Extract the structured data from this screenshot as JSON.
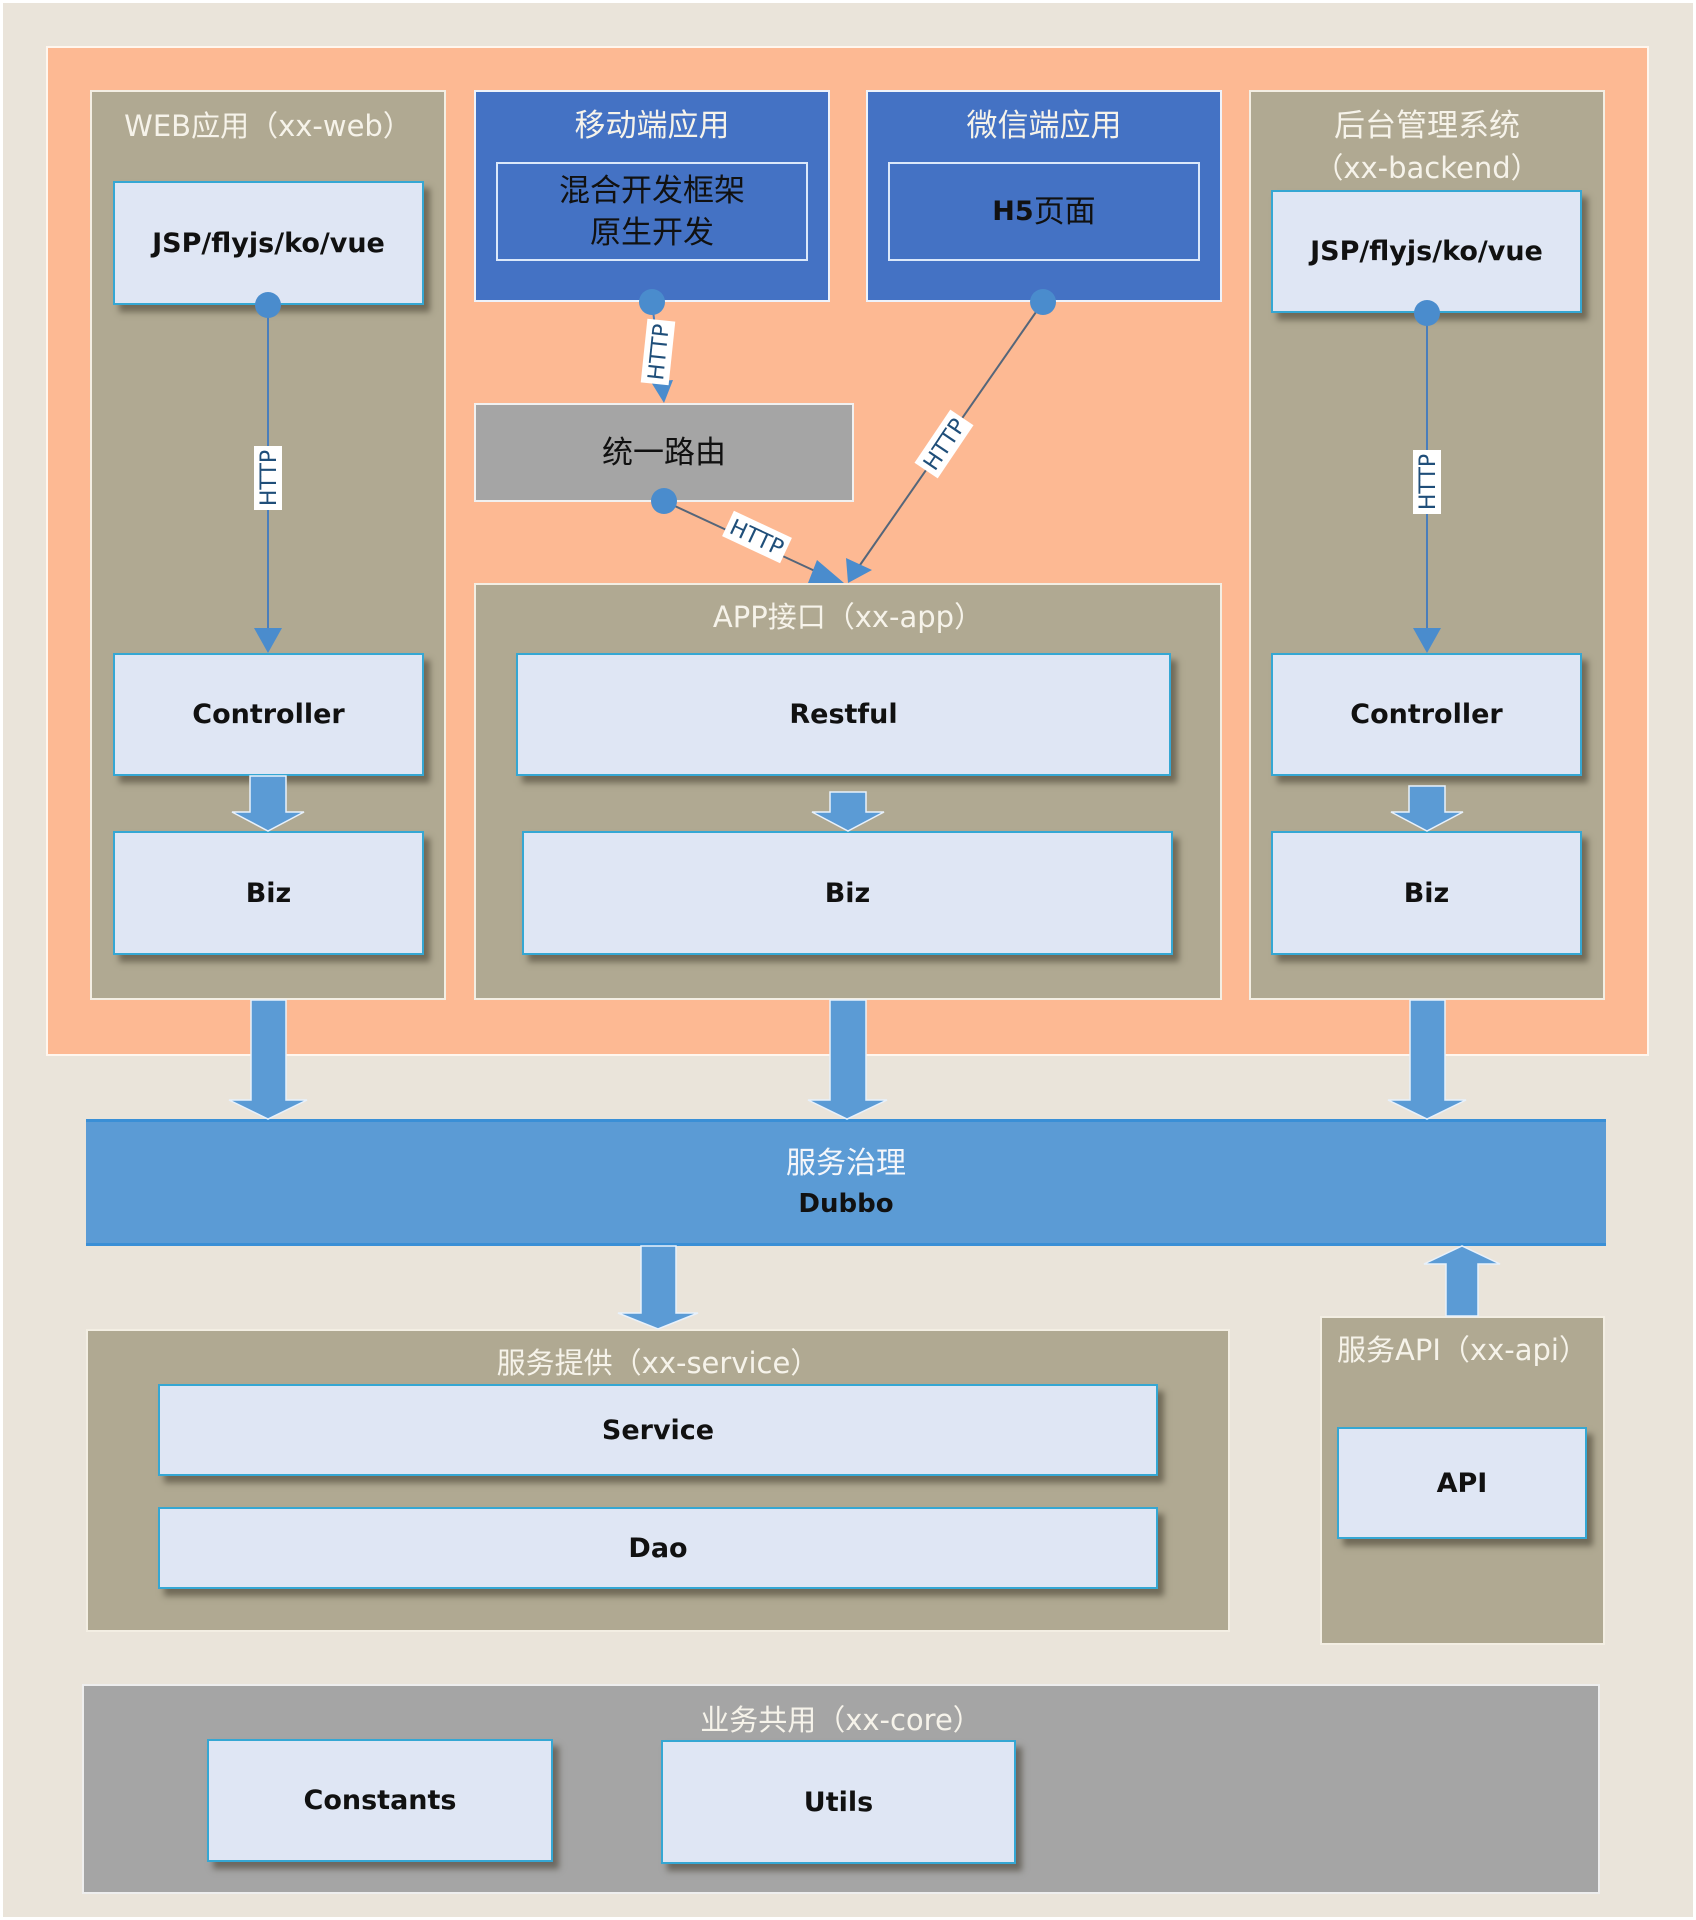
{
  "colors": {
    "background": "#EAE4DA",
    "frontend_zone": "#FDB993",
    "panel": "#B0A992",
    "client_panel": "#4472C4",
    "router": "#A5A5A5",
    "module_fill": "#DFE6F4",
    "module_border": "#35A7D3",
    "arrow": "#5B9BD5",
    "service_bus": "#5B9BD5",
    "core_panel": "#A5A5A5"
  },
  "web": {
    "title": "WEB应用（xx-web）",
    "view": "JSP/flyjs/ko/vue",
    "controller": "Controller",
    "biz": "Biz",
    "link_label": "HTTP"
  },
  "mobile": {
    "title": "移动端应用",
    "line1": "混合开发框架",
    "line2": "原生开发",
    "link_label": "HTTP"
  },
  "wechat": {
    "title": "微信端应用",
    "page_bold": "H5",
    "page_rest": "页面",
    "link_label": "HTTP"
  },
  "router": {
    "label": "统一路由",
    "link_label": "HTTP"
  },
  "backend": {
    "title_line1": "后台管理系统",
    "title_line2": "（xx-backend）",
    "view": "JSP/flyjs/ko/vue",
    "controller": "Controller",
    "biz": "Biz",
    "link_label": "HTTP"
  },
  "app": {
    "title": "APP接口（xx-app）",
    "restful": "Restful",
    "biz": "Biz"
  },
  "governance": {
    "title": "服务治理",
    "subtitle": "Dubbo"
  },
  "service": {
    "title": "服务提供（xx-service）",
    "service": "Service",
    "dao": "Dao"
  },
  "api": {
    "title": "服务API（xx-api）",
    "api": "API"
  },
  "core": {
    "title": "业务共用（xx-core）",
    "constants": "Constants",
    "utils": "Utils"
  }
}
